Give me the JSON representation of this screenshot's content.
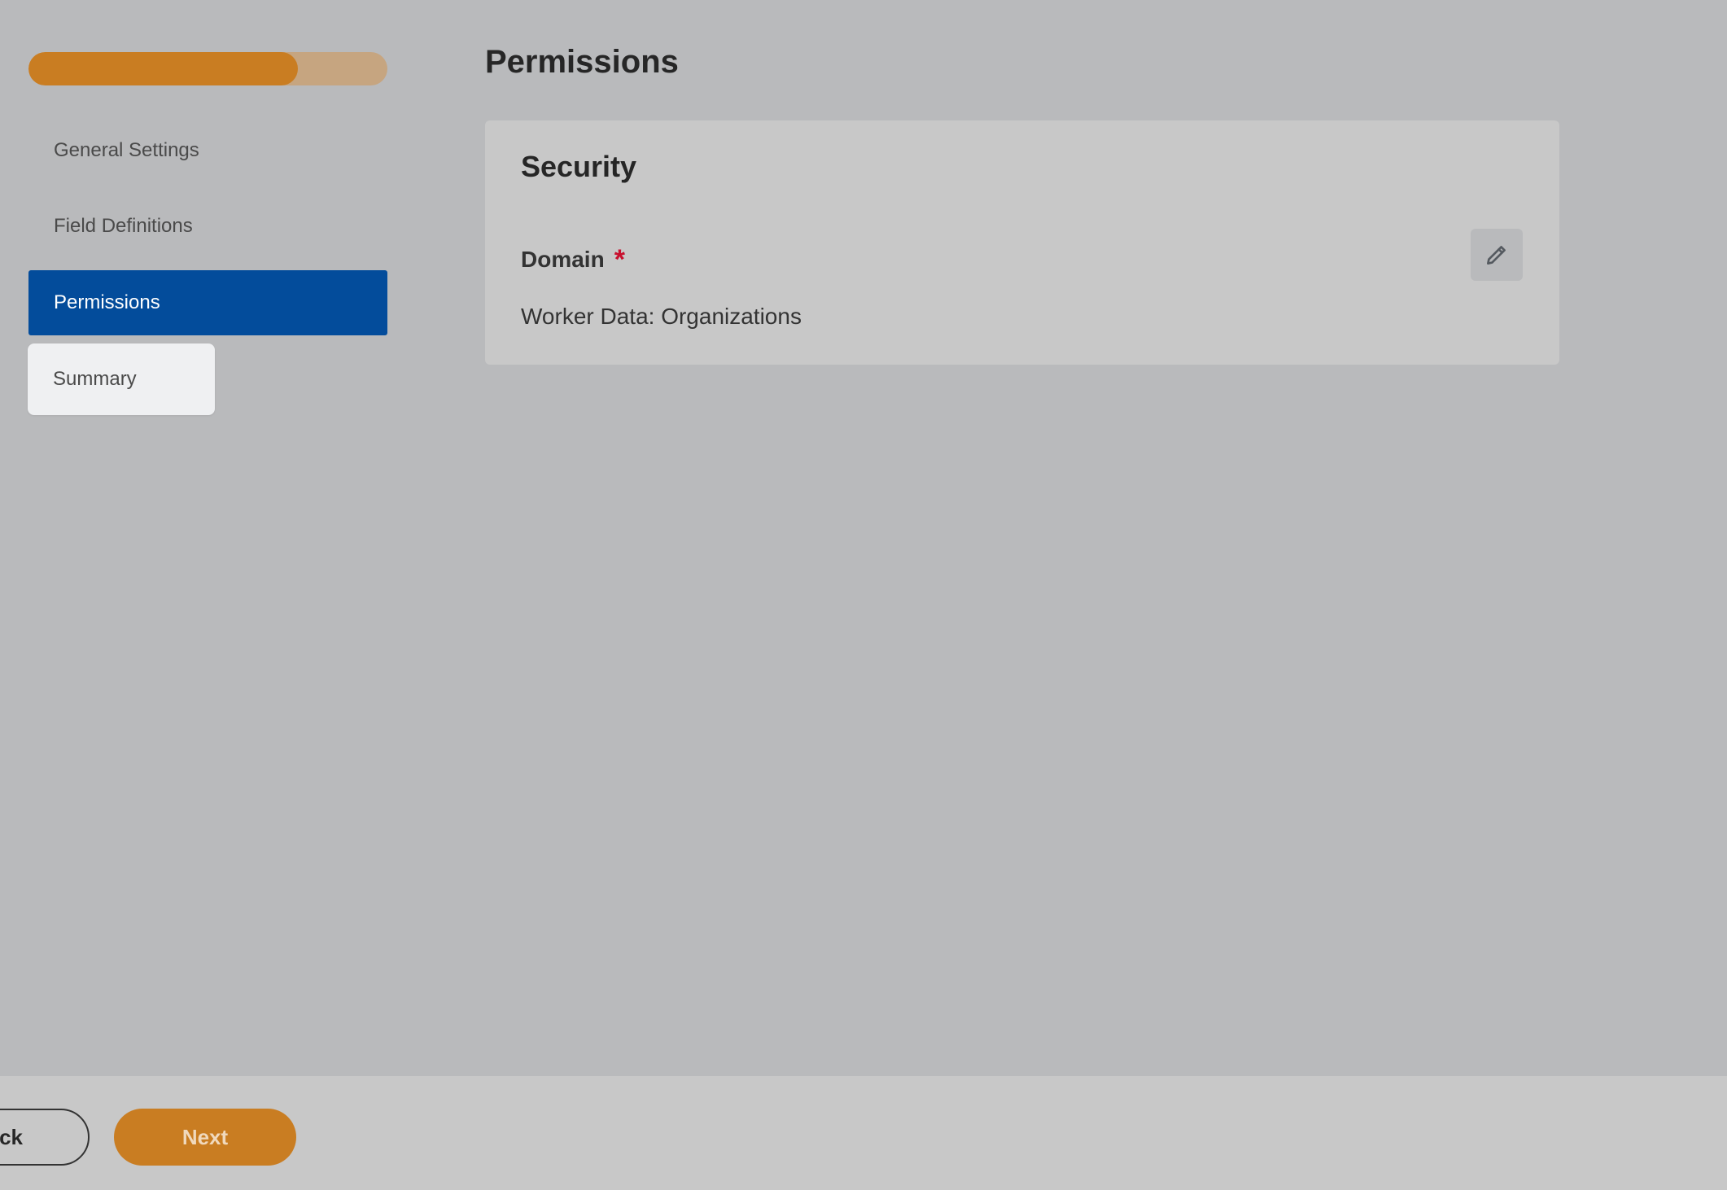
{
  "progress": {
    "completed_fraction": 0.75
  },
  "sidebar": {
    "items": [
      {
        "label": "General Settings"
      },
      {
        "label": "Field Definitions"
      },
      {
        "label": "Permissions"
      },
      {
        "label": "Summary"
      }
    ],
    "active_index": 2
  },
  "main": {
    "title": "Permissions",
    "card": {
      "title": "Security",
      "field_label": "Domain",
      "required_marker": "*",
      "field_value": "Worker Data: Organizations",
      "edit_icon": "pencil-icon"
    }
  },
  "footer": {
    "back_label": "ck",
    "next_label": "Next"
  },
  "colors": {
    "accent": "#c97d22",
    "active_nav": "#034c9b",
    "required": "#c8102e"
  }
}
